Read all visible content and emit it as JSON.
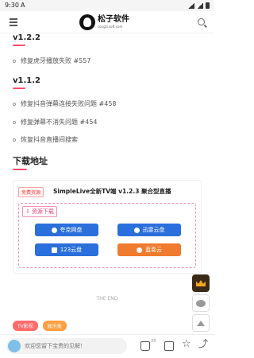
{
  "status": {
    "time": "9:30",
    "app_letter": "A"
  },
  "header": {
    "logo_name": "松子软件",
    "logo_sub": "songzi.soft.com"
  },
  "changelog": [
    {
      "version": "v1.2.2",
      "items": [
        "修复虎牙播放失败 #557"
      ]
    },
    {
      "version": "v1.1.2",
      "items": [
        "修复抖音弹幕连接失败问题 #458",
        "修复弹幕不消失问题 #454",
        "恢复抖音直播间搜索"
      ]
    }
  ],
  "download": {
    "section_title": "下载地址",
    "badge": "免费资源",
    "title": "SimpleLive全新TV端 v1.2.3 聚合型直播",
    "box_label": "资源下载",
    "buttons": [
      {
        "label": "夸克网盘",
        "icon": "quark-icon",
        "color": "#2a6fdb"
      },
      {
        "label": "迅雷云盘",
        "icon": "xunlei-icon",
        "color": "#2a6fdb"
      },
      {
        "label": "123云盘",
        "icon": "pan123-icon",
        "color": "#2a6fdb"
      },
      {
        "label": "蓝奏云",
        "icon": "lanzou-icon",
        "color": "#f07a2d"
      }
    ]
  },
  "the_end": "THE END",
  "tags": [
    "TV影视",
    "娱乐类"
  ],
  "bottom": {
    "comment_placeholder": "欢迎您留下宝贵的见解！",
    "like_count": "33"
  },
  "colors": {
    "accent": "#ff4d6d",
    "button_blue": "#2a6fdb",
    "button_orange": "#f07a2d"
  }
}
